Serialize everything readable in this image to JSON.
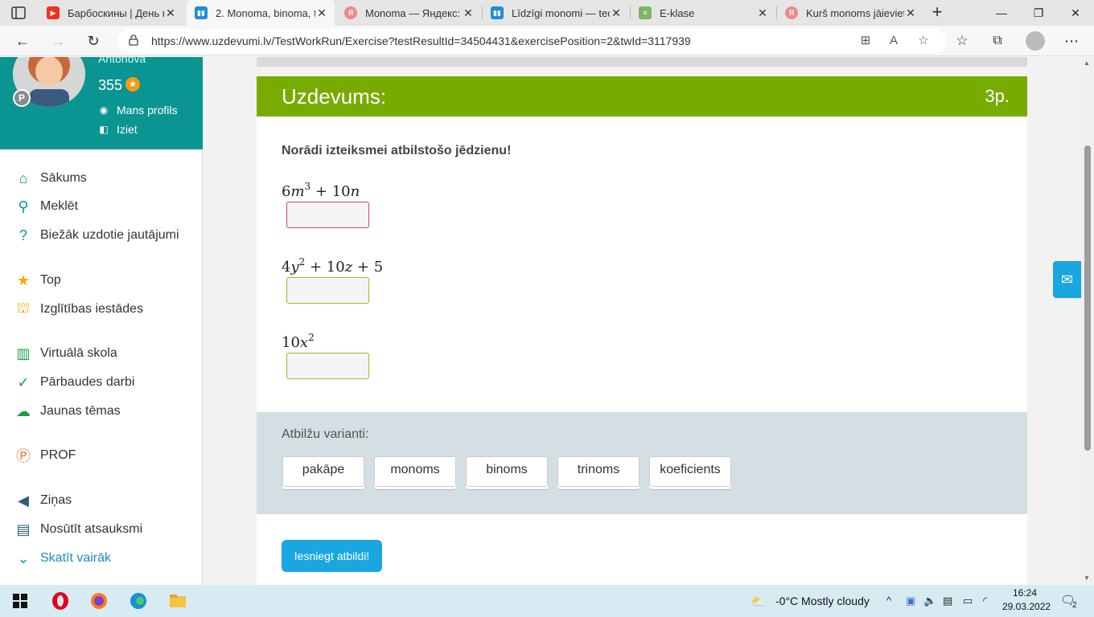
{
  "browser": {
    "tabs": [
      {
        "title": "Барбоскины | День п",
        "color": "#e32"
      },
      {
        "title": "2. Monoma, binoma, t",
        "color": "#1a8fd8",
        "active": true
      },
      {
        "title": "Monoma — Яндекс: н",
        "color": "#d55"
      },
      {
        "title": "Līdzīgi monomi — tec",
        "color": "#1a8fd8"
      },
      {
        "title": "E-klase",
        "color": "#5a9e3c"
      },
      {
        "title": "Kurš monoms jāieviet",
        "color": "#d55"
      }
    ],
    "url": "https://www.uzdevumi.lv/TestWorkRun/Exercise?testResultId=34504431&exercisePosition=2&twId=3117939"
  },
  "profile": {
    "name": "Antonova",
    "points": "355",
    "badge": "P",
    "my_profile": "Mans profils",
    "logout": "Iziet"
  },
  "menu": [
    {
      "label": "Sākums",
      "icon": "home-icon"
    },
    {
      "label": "Meklēt",
      "icon": "search-icon"
    },
    {
      "label": "Biežāk uzdotie jautājumi",
      "icon": "question-icon"
    },
    {
      "label": "Top",
      "icon": "star-icon"
    },
    {
      "label": "Izglītības iestādes",
      "icon": "institution-icon"
    },
    {
      "label": "Virtuālā skola",
      "icon": "book-icon"
    },
    {
      "label": "Pārbaudes darbi",
      "icon": "check-icon"
    },
    {
      "label": "Jaunas tēmas",
      "icon": "cloud-icon"
    },
    {
      "label": "PROF",
      "icon": "prof-icon"
    },
    {
      "label": "Ziņas",
      "icon": "megaphone-icon"
    },
    {
      "label": "Nosūtīt atsauksmi",
      "icon": "feedback-icon"
    },
    {
      "label": "Skatīt vairāk",
      "icon": "chevron-down-icon"
    }
  ],
  "exercise": {
    "title": "Uzdevums:",
    "points": "3p.",
    "instruction": "Norādi izteiksmei atbilstošo jēdzienu!",
    "answers_label": "Atbilžu varianti:",
    "options": [
      "pakāpe",
      "monoms",
      "binoms",
      "trinoms",
      "koeficients"
    ],
    "submit": "Iesniegt atbildi!"
  },
  "taskbar": {
    "weather": "-0°C  Mostly cloudy",
    "time": "16:24",
    "date": "29.03.2022",
    "notifications": "2"
  }
}
